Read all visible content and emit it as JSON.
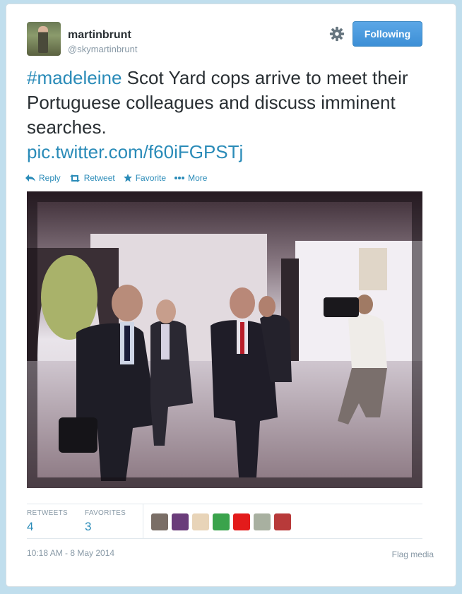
{
  "user": {
    "full_name": "martinbrunt",
    "screen_name": "@skymartinbrunt",
    "avatar_icon": "profile-photo"
  },
  "follow_button": {
    "label": "Following",
    "color": "#4a9ae0"
  },
  "settings_icon": "gear-icon",
  "tweet": {
    "hashtag": "#madeleine",
    "text": " Scot Yard cops arrive to meet their Portuguese  colleagues and discuss imminent searches.",
    "link": "pic.twitter.com/f60iFGPSTj"
  },
  "actions": [
    {
      "label": "Reply",
      "icon": "reply-icon"
    },
    {
      "label": "Retweet",
      "icon": "retweet-icon"
    },
    {
      "label": "Favorite",
      "icon": "star-icon"
    },
    {
      "label": "More",
      "icon": "more-dots-icon"
    }
  ],
  "stats": {
    "retweets_label": "RETWEETS",
    "retweets_value": "4",
    "favorites_label": "FAVORITES",
    "favorites_value": "3"
  },
  "favoriter_avatars": [
    {
      "icon": "avatar-photo",
      "color": "#7a6e66"
    },
    {
      "icon": "avatar-photo",
      "color": "#6a3c7a"
    },
    {
      "icon": "avatar-photo",
      "color": "#e8d4b8"
    },
    {
      "icon": "avatar-photo",
      "color": "#3aa34c"
    },
    {
      "icon": "flag-icon",
      "color": "#e31b1b"
    },
    {
      "icon": "avatar-photo",
      "color": "#a8b0a0"
    },
    {
      "icon": "avatar-photo",
      "color": "#b83a3a"
    }
  ],
  "timestamp": "10:18 AM - 8 May 2014",
  "flag_media": "Flag media",
  "colors": {
    "link": "#2a8bb8",
    "text": "#292f33",
    "muted": "#8899a6",
    "background": "#c0deed"
  }
}
